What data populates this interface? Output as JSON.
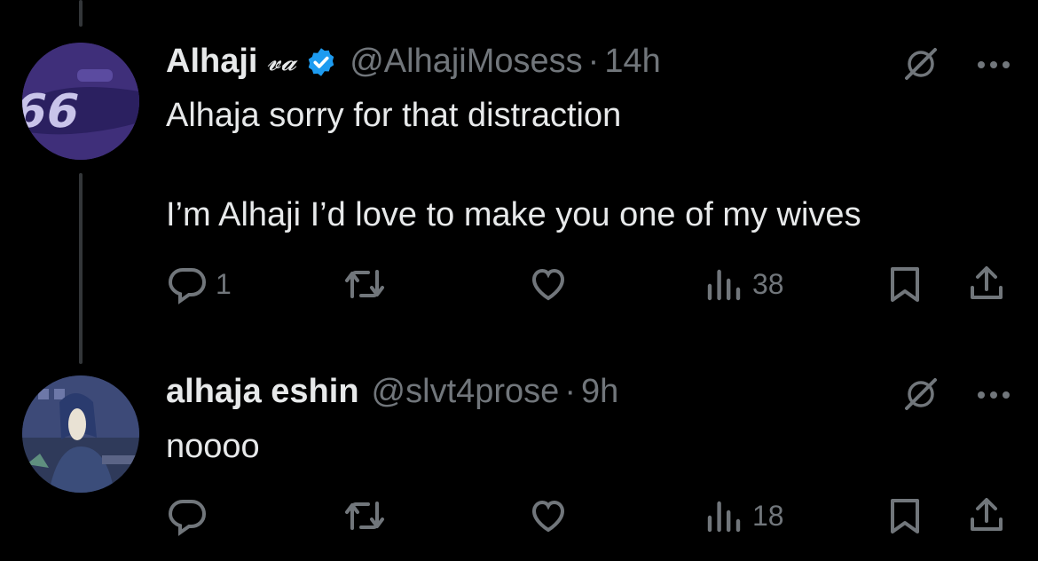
{
  "tweets": [
    {
      "display_name": "Alhaji",
      "signature": "𝓿𝓪",
      "handle": "@AlhajiMosess",
      "separator": "·",
      "time": "14h",
      "verified": true,
      "text": "Alhaja sorry for that distraction\n\nI’m Alhaji I’d love to make you one of my wives",
      "actions": {
        "replies": "1",
        "reposts": "",
        "likes": "",
        "views": "38"
      }
    },
    {
      "display_name": "alhaja eshin",
      "handle": "@slvt4prose",
      "separator": "·",
      "time": "9h",
      "verified": false,
      "text": "noooo",
      "actions": {
        "replies": "",
        "reposts": "",
        "likes": "",
        "views": "18"
      }
    }
  ],
  "colors": {
    "background": "#000000",
    "text": "#e7e9ea",
    "muted": "#71767b",
    "verified": "#1d9bf0",
    "thread_line": "#333639"
  },
  "icons": [
    "grok-icon",
    "more-icon",
    "reply-icon",
    "repost-icon",
    "like-icon",
    "views-icon",
    "bookmark-icon",
    "share-icon",
    "verified-badge-icon"
  ]
}
